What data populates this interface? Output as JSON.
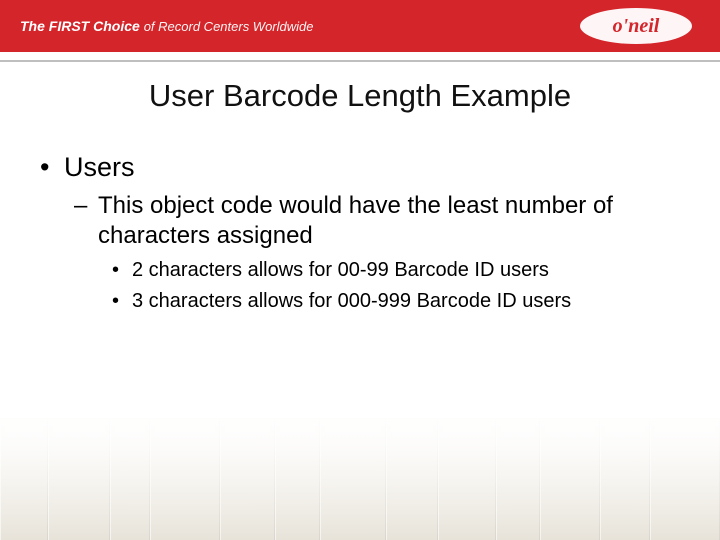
{
  "header": {
    "tagline_first": "The FIRST",
    "tagline_choice": "Choice",
    "tagline_rest": " of Record Centers Worldwide",
    "logo_text": "o'neil"
  },
  "title": "User Barcode Length Example",
  "bullets": {
    "lvl1_0": "Users",
    "lvl2_0": "This object code would have the least number of characters assigned",
    "lvl3_0": "2 characters allows for 00-99 Barcode ID users",
    "lvl3_1": "3 characters allows for 000-999 Barcode ID users"
  }
}
